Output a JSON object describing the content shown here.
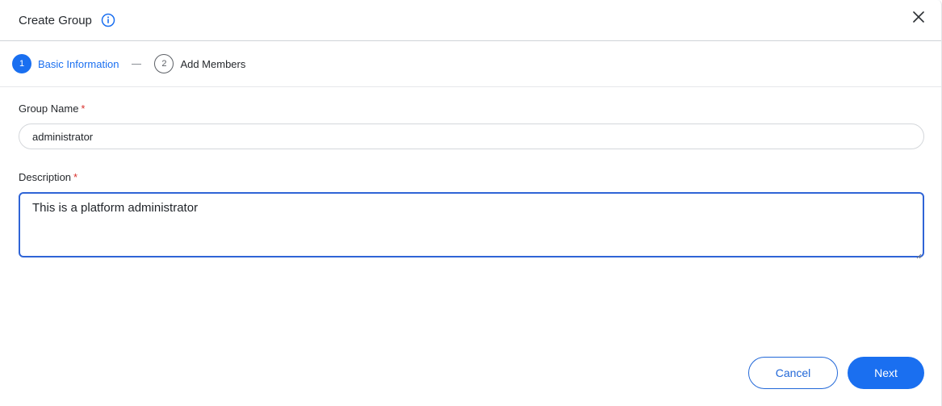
{
  "dialog": {
    "title": "Create Group",
    "info_icon": "info-icon",
    "close_icon": "close-icon"
  },
  "steps": [
    {
      "number": "1",
      "label": "Basic Information",
      "state": "active"
    },
    {
      "number": "2",
      "label": "Add Members",
      "state": "inactive"
    }
  ],
  "form": {
    "group_name": {
      "label": "Group Name",
      "required_mark": "*",
      "value": "administrator"
    },
    "description": {
      "label": "Description",
      "required_mark": "*",
      "value": "This is a platform administrator"
    }
  },
  "footer": {
    "cancel_label": "Cancel",
    "next_label": "Next"
  },
  "colors": {
    "accent": "#1a6ff0",
    "required": "#d9302c",
    "focus_border": "#2f64d6"
  }
}
